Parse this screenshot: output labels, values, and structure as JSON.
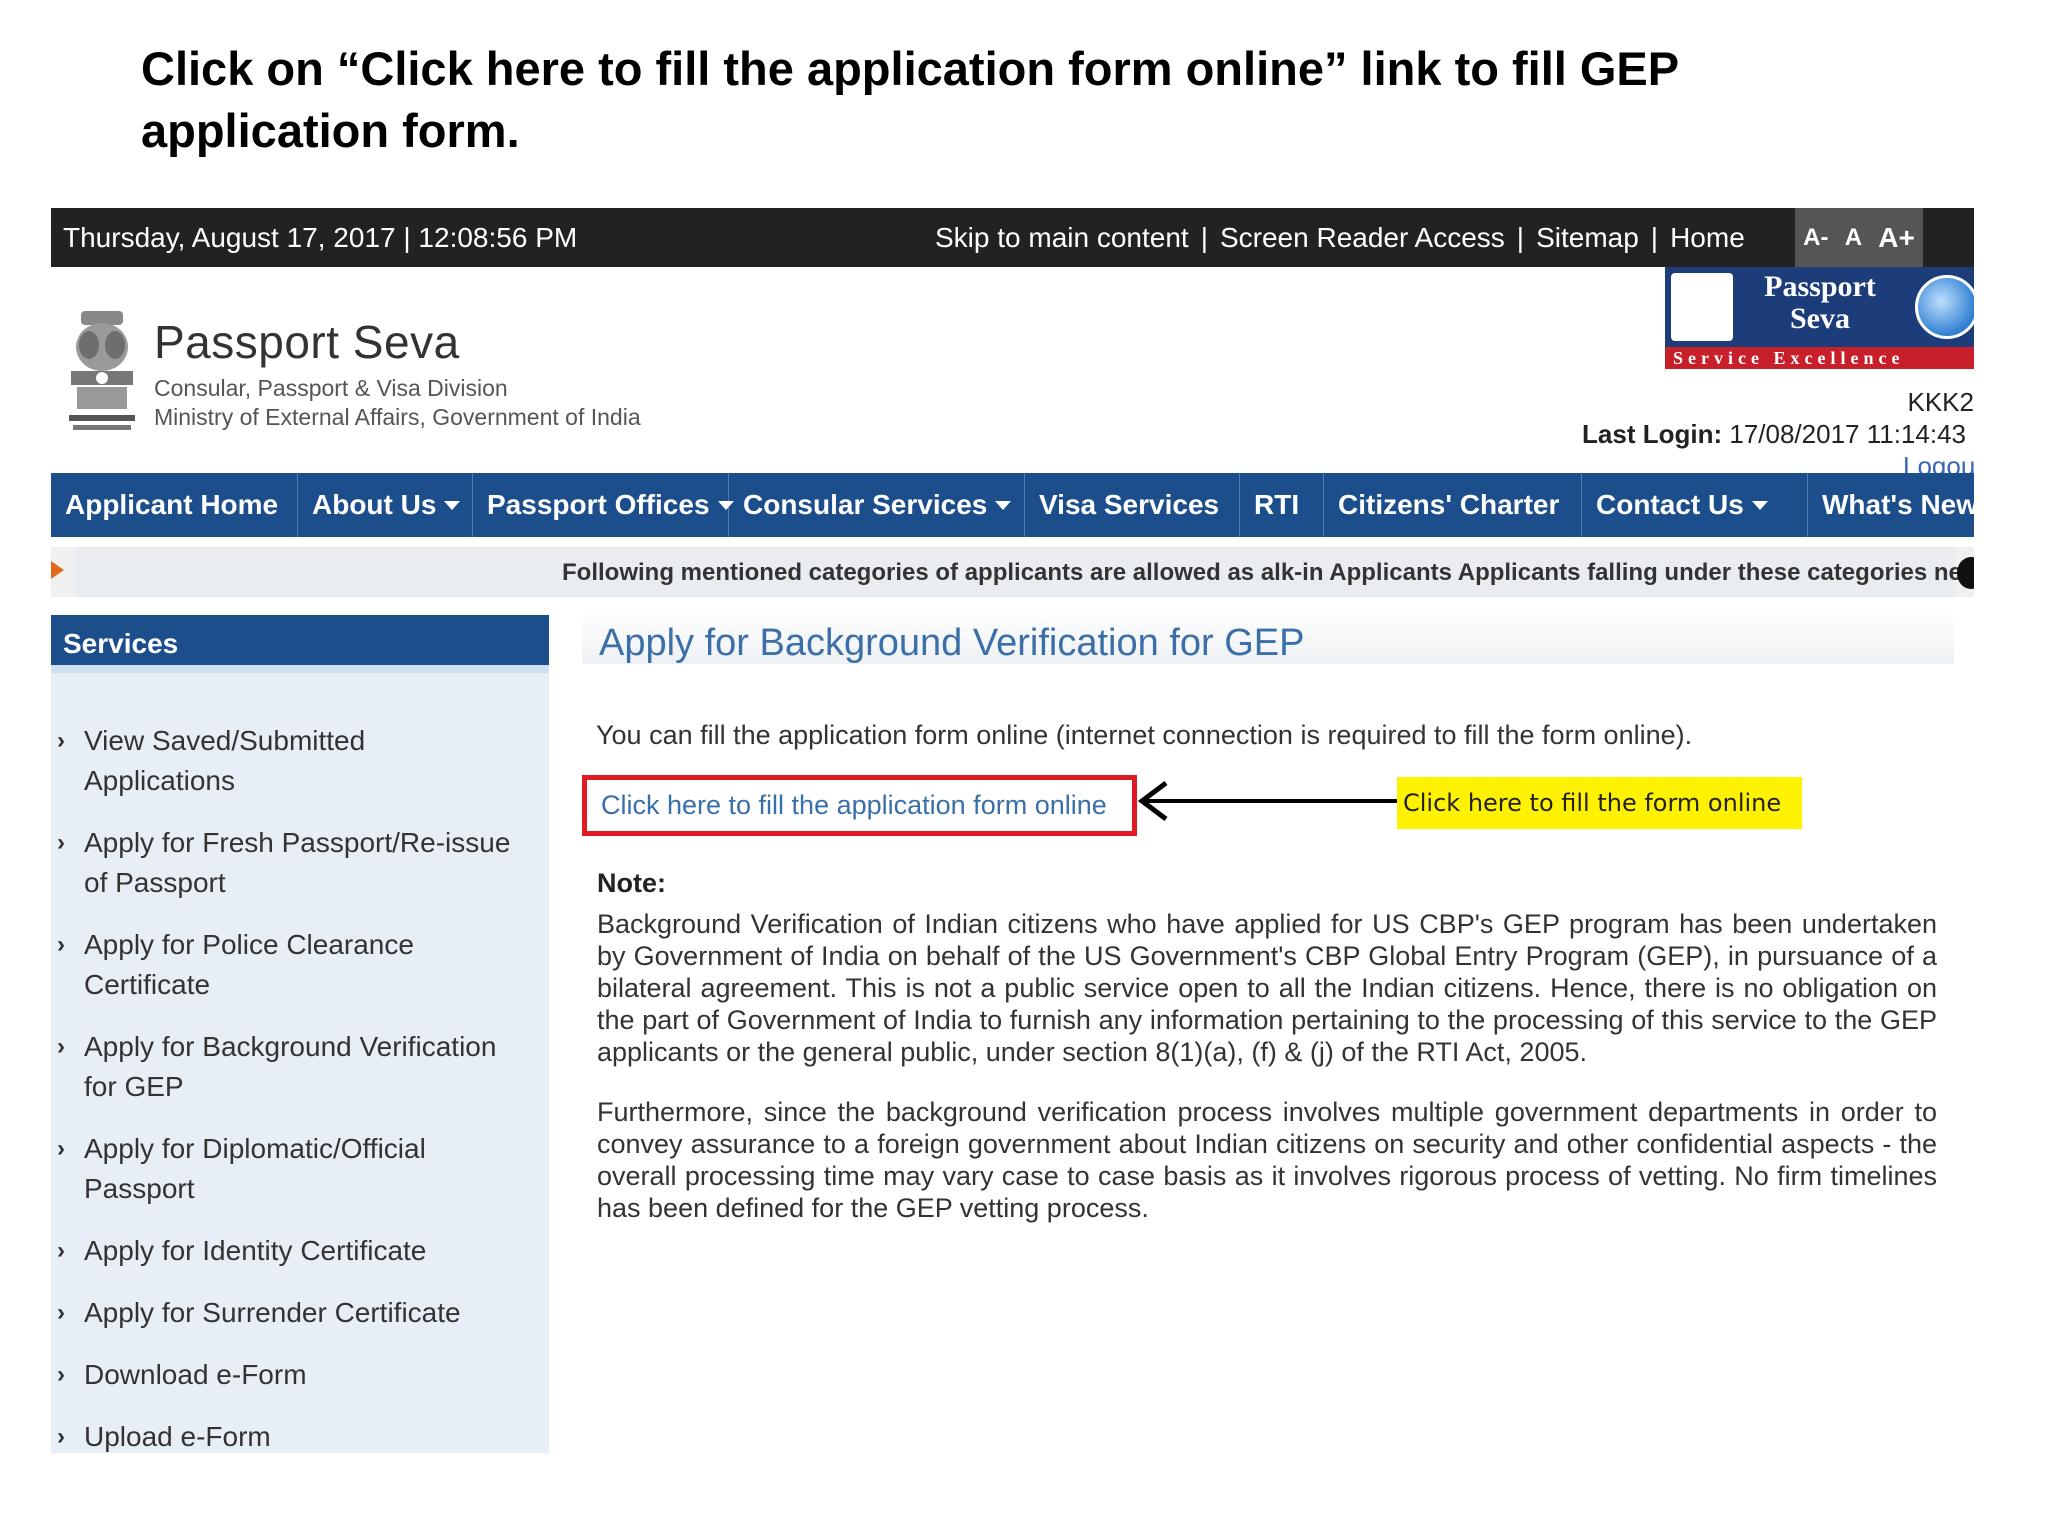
{
  "instruction": "Click on “Click here to fill the application form online” link to fill GEP application form.",
  "topbar": {
    "datetime": "Thursday,  August  17, 2017 | 12:08:56 PM",
    "skip": "Skip to main content",
    "screen_reader": "Screen Reader Access",
    "sitemap": "Sitemap",
    "home": "Home",
    "sep": "|",
    "font_small": "A-",
    "font_normal": "A",
    "font_large": "A+"
  },
  "header": {
    "site_name": "Passport Seva",
    "sub1": "Consular, Passport & Visa Division",
    "sub2": "Ministry of External Affairs, Government of India",
    "logo_text": "Passport Seva",
    "logo_tagline": "Service Excellence",
    "user_id": "KKK2",
    "last_login_label": "Last Login:",
    "last_login_value": "17/08/2017 11:14:43",
    "logout": "Logout"
  },
  "nav": {
    "items": [
      {
        "label": "Applicant Home"
      },
      {
        "label": "About Us"
      },
      {
        "label": "Passport Offices"
      },
      {
        "label": "Consular Services"
      },
      {
        "label": "Visa Services"
      },
      {
        "label": "RTI"
      },
      {
        "label": "Citizens' Charter"
      },
      {
        "label": "Contact Us"
      },
      {
        "label": "What's New"
      }
    ]
  },
  "ticker": {
    "message": "Following mentioned categories of applicants are allowed as alk-in Applicants Applicants falling under these categories need to"
  },
  "sidebar": {
    "title": "Services",
    "items": [
      "View Saved/Submitted Applications",
      "Apply for Fresh Passport/Re-issue of Passport",
      "Apply for Police Clearance Certificate",
      "Apply for Background Verification for GEP",
      "Apply for Diplomatic/Official Passport",
      "Apply for Identity Certificate",
      "Apply for Surrender Certificate",
      "Download e-Form",
      "Upload e-Form"
    ]
  },
  "main": {
    "heading": "Apply for Background Verification for GEP",
    "lead": "You can fill the application form online (internet connection is required to fill the form online).",
    "cta_link": "Click here to fill the application form online",
    "callout": "Click here to fill the form online",
    "note_label": "Note:",
    "para1": "Background Verification of Indian citizens who have applied for US CBP's GEP program has been undertaken by Government of India on behalf of the US Government's CBP Global Entry Program (GEP), in pursuance of a bilateral agreement. This is not a public service open to all the Indian citizens. Hence, there is no obligation on the part of Government of India to furnish any information pertaining to the processing of this service to the GEP applicants or the general public, under section 8(1)(a), (f) & (j) of the RTI Act, 2005.",
    "para2": "Furthermore, since the background verification process involves multiple government departments in order to convey assurance to a foreign government about Indian citizens on security and other confidential aspects - the overall processing time may vary case to case basis as it involves rigorous process of vetting. No firm timelines has been defined for the GEP vetting process."
  },
  "colors": {
    "nav_blue": "#1c4e8c",
    "topbar": "#222222",
    "highlight_red": "#e01b24",
    "callout_yellow": "#fff200",
    "link_blue": "#3b6fa8"
  }
}
